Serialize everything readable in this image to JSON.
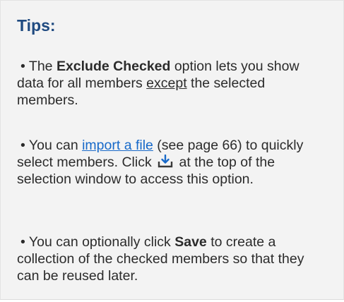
{
  "tips": {
    "title": "Tips:",
    "tip1": {
      "bullet": "•",
      "text_a": "The ",
      "bold": "Exclude Checked",
      "text_b": " option lets you show data for all members ",
      "underlined": "except",
      "text_c": " the selected members."
    },
    "tip2": {
      "bullet": "•",
      "text_a": "You can ",
      "link": "import a file",
      "text_b": " (see page 66) to quickly select members. Click ",
      "icon": "import-icon",
      "text_c": " at the top of the selection window to access this option."
    },
    "tip3": {
      "bullet": "•",
      "text_a": "You can optionally click ",
      "bold": "Save",
      "text_b": " to create a collection of the checked members so that they can be reused later."
    }
  },
  "colors": {
    "title": "#1f4a80",
    "link": "#1769c9",
    "box_background": "#f3f3f3",
    "icon_accent": "#1769c9"
  }
}
